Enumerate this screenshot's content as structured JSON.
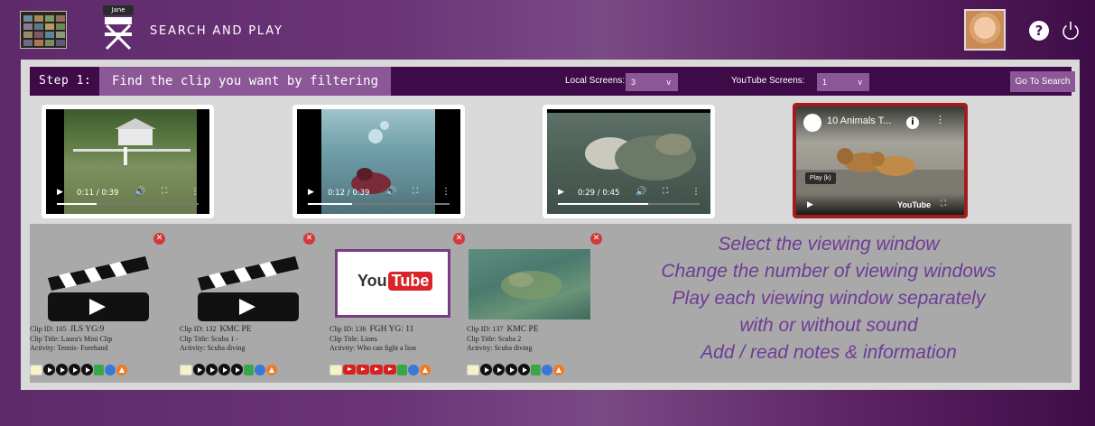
{
  "header": {
    "app_title": "SEARCH AND PLAY",
    "user_name": "Jane",
    "help_label": "?"
  },
  "stepbar": {
    "step_label": "Step 1:",
    "step_title": "Find the clip you want by filtering",
    "local_screens_label": "Local Screens:",
    "local_screens_value": "3",
    "youtube_screens_label": "YouTube Screens:",
    "youtube_screens_value": "1",
    "go_button": "Go To Search",
    "arrow": "v"
  },
  "screens": [
    {
      "time": "0:11 / 0:39",
      "progress": 0.28
    },
    {
      "time": "0:12 / 0:39",
      "progress": 0.31
    },
    {
      "time": "0:29 / 0:45",
      "progress": 0.64
    }
  ],
  "youtube_screen": {
    "title": "10 Animals T...",
    "info": "i",
    "tooltip": "Play (k)",
    "brand": "YouTube"
  },
  "clips": [
    {
      "id_line": "Clip ID: 105",
      "id_extra": "JLS  YG:9",
      "title": "Clip Title: Laura's Mini Clip",
      "activity": "Activity: Tennis- Forehand",
      "type": "local"
    },
    {
      "id_line": "Clip ID: 132",
      "id_extra": "KMC  PE",
      "title": "Clip Title: Scuba 1 -",
      "activity": "Activity: Scuba diving",
      "type": "local"
    },
    {
      "id_line": "Clip ID: 136",
      "id_extra": "FGH  YG: 11",
      "title": "Clip Title: Lions",
      "activity": "Activity: Who can fight a lion",
      "type": "youtube"
    },
    {
      "id_line": "Clip ID: 137",
      "id_extra": "KMC  PE",
      "title": "Clip Title: Scuba 2",
      "activity": "Activity: Scuba diving",
      "type": "image"
    }
  ],
  "youtube_thumb": {
    "you": "You",
    "tube": "Tube"
  },
  "features": [
    "Select the viewing window",
    "Change the number of viewing windows",
    "Play each viewing window separately",
    "with or without sound",
    "Add / read notes & information"
  ],
  "colors": {
    "accent": "#8b5796",
    "stepbar": "#3e0a48",
    "youtube_border": "#a31c1c",
    "features_text": "#6f3b96"
  },
  "icons": [
    "close-icon",
    "note-icon",
    "play-icon",
    "youtube-play-icon",
    "save-icon",
    "notes-icon",
    "upload-icon",
    "power-icon",
    "help-icon"
  ]
}
